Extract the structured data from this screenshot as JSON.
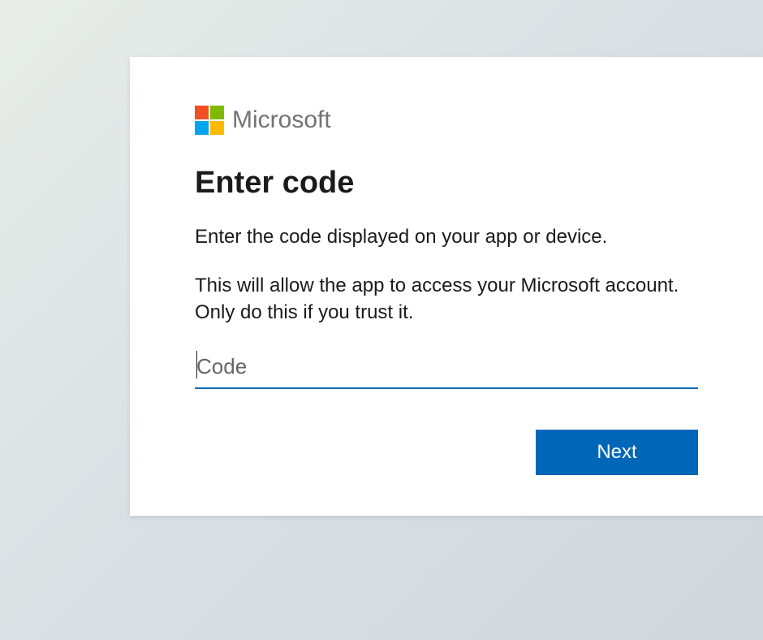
{
  "brand": {
    "name": "Microsoft"
  },
  "dialog": {
    "title": "Enter code",
    "instruction1": "Enter the code displayed on your app or device.",
    "instruction2": "This will allow the app to access your Microsoft account. Only do this if you trust it.",
    "code_placeholder": "Code",
    "code_value": "",
    "next_label": "Next"
  }
}
